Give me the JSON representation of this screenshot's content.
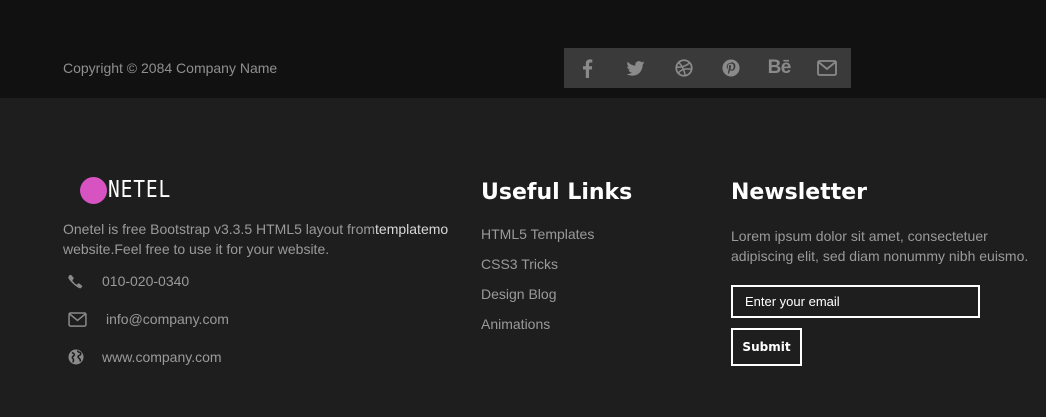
{
  "copyright": "Copyright © 2084 Company Name",
  "social": [
    {
      "icon": "facebook-icon"
    },
    {
      "icon": "twitter-icon"
    },
    {
      "icon": "dribbble-icon"
    },
    {
      "icon": "pinterest-icon"
    },
    {
      "icon": "behance-icon",
      "text": "Bē"
    },
    {
      "icon": "envelope-icon"
    }
  ],
  "brand": {
    "logo_text": "NETEL",
    "accent": "#d653c1",
    "about_prefix": "Onetel is free Bootstrap v3.3.5 HTML5 layout from",
    "about_link": "templatemo",
    "about_suffix": " website.Feel free to use it for your website."
  },
  "contact": {
    "phone": "010-020-0340",
    "email": "info@company.com",
    "website": "www.company.com"
  },
  "useful_links": {
    "title": "Useful Links",
    "items": [
      "HTML5 Templates",
      "CSS3 Tricks",
      "Design Blog",
      "Animations"
    ]
  },
  "newsletter": {
    "title": "Newsletter",
    "text": "Lorem ipsum dolor sit amet, consectetuer adipiscing elit, sed diam nonummy nibh euismo.",
    "placeholder": "Enter your email",
    "submit_label": "Submit"
  }
}
